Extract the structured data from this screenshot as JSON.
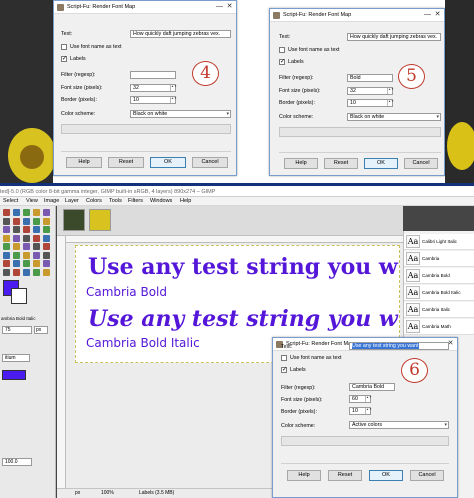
{
  "dialog": {
    "title": "Script-Fu: Render Font Map",
    "text_label": "Text:",
    "text_value": "How quickly daft jumping zebras vex.",
    "use_font_name_label": "Use font name as text",
    "labels_label": "Labels",
    "filter_label": "Filter (regexp):",
    "font_size_label": "Font size (pixels):",
    "border_label": "Border (pixels):",
    "color_scheme_label": "Color scheme:",
    "help_label": "Help",
    "reset_label": "Reset",
    "ok_label": "OK",
    "cancel_label": "Cancel",
    "check_glyph": "✓",
    "close_glyph": "✕",
    "min_glyph": "—"
  },
  "dialog4": {
    "step": "4",
    "filter_value": "",
    "font_size": "32",
    "border": "10",
    "color_scheme": "Black on white",
    "use_font_name": false,
    "labels": true
  },
  "dialog5": {
    "step": "5",
    "filter_value": "Bold",
    "font_size": "32",
    "border": "10",
    "color_scheme": "Black on white",
    "use_font_name": false,
    "labels": true
  },
  "dialog6": {
    "step": "6",
    "text_value": "Use any test string you want",
    "filter_value": "Cambria Bold",
    "font_size": "60",
    "border": "10",
    "color_scheme": "Active colors",
    "use_font_name": false,
    "labels": true
  },
  "gimp": {
    "title": "ted]-5.0 (RGB color 8-bit gamma integer, GIMP built-in sRGB, 4 layers) 890x274 – GIMP",
    "menu": [
      "Select",
      "View",
      "Image",
      "Layer",
      "Colors",
      "Tools",
      "Filters",
      "Windows",
      "Help"
    ],
    "render_line1": "Use any test string you w",
    "render_label1": "Cambria Bold",
    "render_line2": "Use any test string you w",
    "render_label2": "Cambria Bold Italic",
    "status_unit": "px",
    "status_zoom": "100%",
    "status_layers": "Labels (3.5 MB)",
    "toolbox_font": "ambria Bold Italic",
    "toolbox_size": "75",
    "toolbox_unit": "px",
    "toolbox_justify": "itium",
    "toolbox_num": "100.0"
  },
  "font_list": {
    "glyph": "Aa",
    "items": [
      "Calibri Light Italic",
      "Cambria",
      "Cambria Bold",
      "Cambria Bold Italic",
      "Cambria Italic",
      "Cambria Math"
    ]
  },
  "colors": {
    "fg": "#4b1cf0",
    "render": "#5416d8",
    "annotation": "#c0392b",
    "separator": "#13327a"
  }
}
